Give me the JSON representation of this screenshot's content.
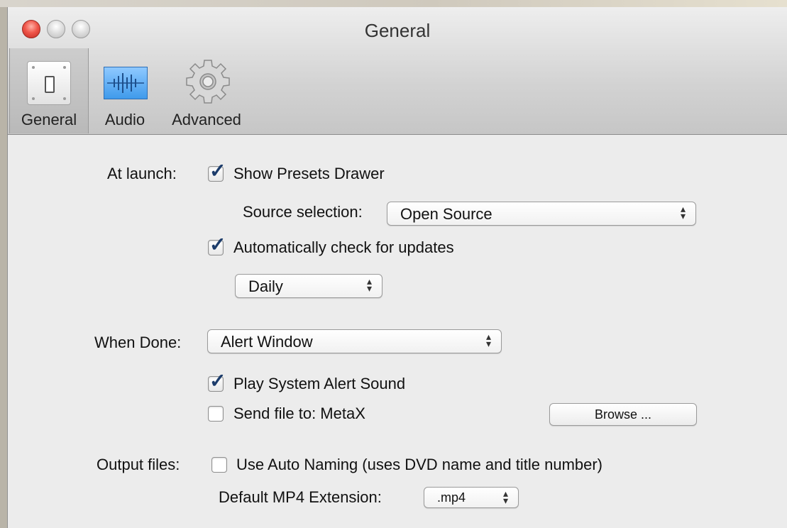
{
  "window": {
    "title": "General"
  },
  "toolbar": {
    "general_label": "General",
    "audio_label": "Audio",
    "advanced_label": "Advanced",
    "selected": "General"
  },
  "launch": {
    "label": "At launch:",
    "show_presets_drawer": {
      "label": "Show Presets Drawer",
      "checked": true
    },
    "source_selection": {
      "label": "Source selection:",
      "value": "Open Source"
    },
    "auto_update": {
      "label": "Automatically check for updates",
      "checked": true
    },
    "update_frequency": {
      "value": "Daily"
    }
  },
  "done": {
    "label": "When Done:",
    "action": {
      "value": "Alert Window"
    },
    "play_sound": {
      "label": "Play System Alert Sound",
      "checked": true
    },
    "send_file": {
      "label": "Send file to: MetaX",
      "checked": false
    },
    "browse_label": "Browse ..."
  },
  "output": {
    "label": "Output files:",
    "auto_naming": {
      "label": "Use Auto Naming (uses DVD name and title number)",
      "checked": false
    },
    "extension": {
      "label": "Default MP4 Extension:",
      "value": ".mp4"
    }
  },
  "icons": {
    "close": "close-icon",
    "minimize": "minimize-icon",
    "zoom": "zoom-icon",
    "general": "light-switch-icon",
    "audio": "waveform-icon",
    "advanced": "gear-icon",
    "popup_arrows": "up-down-arrows-icon",
    "checkmark": "checkmark-icon"
  },
  "colors": {
    "close_button": "#f0574b",
    "audio_icon": "#4aa3f0",
    "checkmark": "#1c3c6b",
    "window_bg": "#ececec"
  }
}
